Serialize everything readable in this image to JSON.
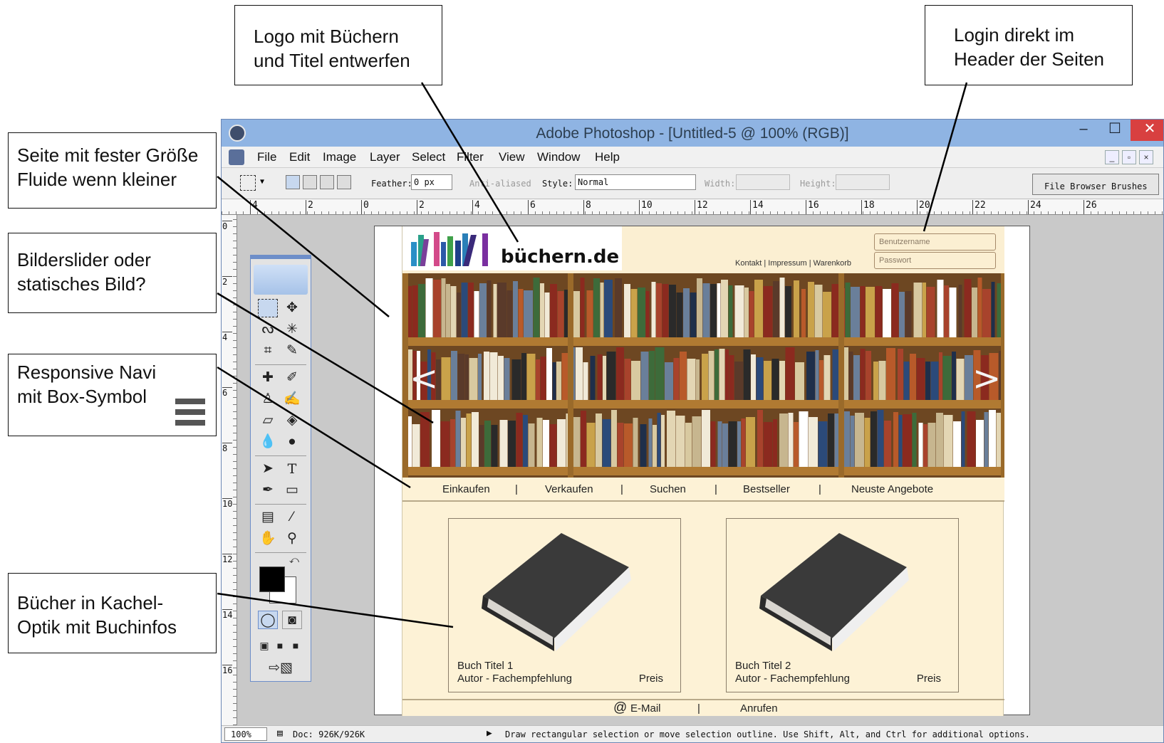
{
  "callouts": {
    "logo": [
      "Logo mit Büchern",
      "und Titel entwerfen"
    ],
    "login": [
      "Login direkt im",
      "Header der Seiten"
    ],
    "page_size": [
      "Seite mit fester Größe",
      "Fluide wenn kleiner"
    ],
    "slider": [
      "Bilderslider oder",
      "statisches Bild?"
    ],
    "nav": [
      "Responsive Navi",
      "mit Box-Symbol"
    ],
    "tiles": [
      "Bücher in Kachel-",
      "Optik mit Buchinfos"
    ]
  },
  "window": {
    "title": "Adobe Photoshop - [Untitled-5 @ 100% (RGB)]",
    "minimize": "–",
    "maximize": "☐",
    "close": "✕"
  },
  "menu": [
    "File",
    "Edit",
    "Image",
    "Layer",
    "Select",
    "Filter",
    "View",
    "Window",
    "Help"
  ],
  "options": {
    "feather_label": "Feather:",
    "feather_value": "0 px",
    "anti_aliased": "Anti-aliased",
    "style_label": "Style:",
    "style_value": "Normal",
    "width_label": "Width:",
    "height_label": "Height:",
    "palette_tabs": [
      "File Browser",
      "Brushes"
    ]
  },
  "ruler": {
    "horizontal": [
      "4",
      "2",
      "0",
      "2",
      "4",
      "6",
      "8",
      "10",
      "12",
      "14",
      "16",
      "18",
      "20",
      "22",
      "24",
      "26"
    ],
    "vertical": [
      "0",
      "2",
      "4",
      "6",
      "8",
      "10",
      "12",
      "14",
      "16"
    ]
  },
  "status": {
    "zoom": "100%",
    "doc": "Doc: 926K/926K",
    "hint": "Draw rectangular selection or move selection outline. Use Shift, Alt, and Ctrl for additional options."
  },
  "site": {
    "logo_text": "büchern.de",
    "header_links": "Kontakt | Impressum | Warenkorb",
    "username_placeholder": "Benutzername",
    "password_placeholder": "Passwort",
    "slider_prev": "<",
    "slider_next": ">",
    "nav": [
      "Einkaufen",
      "|",
      "Verkaufen",
      "|",
      "Suchen",
      "|",
      "Bestseller",
      "|",
      "Neuste Angebote"
    ],
    "books": [
      {
        "title": "Buch Titel 1",
        "author": "Autor - Fachempfehlung",
        "price": "Preis"
      },
      {
        "title": "Buch Titel 2",
        "author": "Autor - Fachempfehlung",
        "price": "Preis"
      }
    ],
    "footer": {
      "email_icon": "@",
      "email": "E-Mail",
      "sep": "|",
      "call": "Anrufen"
    }
  },
  "colors": {
    "titlebar": "#8fb4e3",
    "site_background": "#fdf2d6",
    "close_button": "#d84040"
  }
}
